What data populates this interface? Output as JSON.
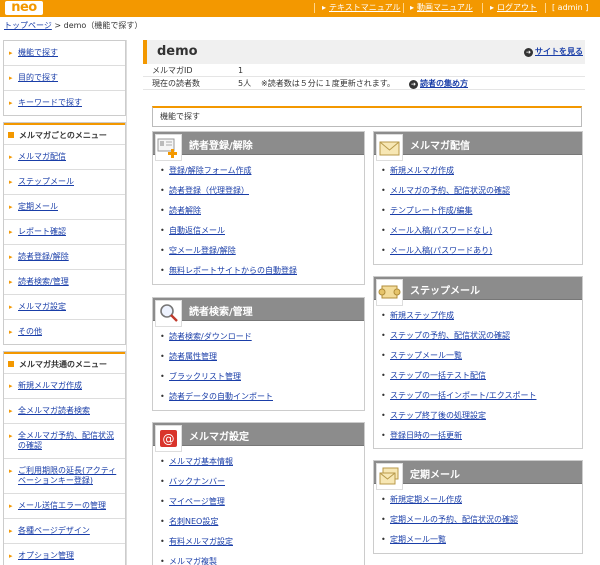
{
  "header": {
    "logo": "neo",
    "links": [
      {
        "label": "テキストマニュアル"
      },
      {
        "label": "動画マニュアル"
      },
      {
        "label": "ログアウト"
      }
    ],
    "user": "[ admin ]"
  },
  "breadcrumb": {
    "home": "トップページ",
    "sep": ">",
    "current": "demo（機能で探す）"
  },
  "sidebar": {
    "top_items": [
      "機能で探す",
      "目的で探す",
      "キーワードで探す"
    ],
    "magazine_menu": {
      "title": "メルマガごとのメニュー",
      "items": [
        "メルマガ配信",
        "ステップメール",
        "定期メール",
        "レポート確認",
        "読者登録/解除",
        "読者検索/管理",
        "メルマガ設定",
        "その他"
      ]
    },
    "common_menu": {
      "title": "メルマガ共通のメニュー",
      "items": [
        "新規メルマガ作成",
        "全メルマガ読者検索",
        "全メルマガ予約、配信状況の確認",
        "ご利用期限の延長(アクティベーションキー登録)",
        "メール送信エラーの管理",
        "各種ページデザイン",
        "オプション管理"
      ]
    }
  },
  "main": {
    "title": "demo",
    "site_link": "サイトを見る",
    "info": [
      {
        "key": "メルマガID",
        "value": "1"
      },
      {
        "key": "現在の読者数",
        "value": "5人",
        "note": "※読者数は５分に１度更新されます。",
        "link": "読者の集め方"
      }
    ],
    "func_label": "機能で探す",
    "panels": {
      "subscribe": {
        "title": "読者登録/解除",
        "items": [
          "登録/解除フォーム作成",
          "読者登録（代理登録）",
          "読者解除",
          "自動返信メール",
          "空メール登録/解除",
          "無料レポートサイトからの自動登録"
        ]
      },
      "search": {
        "title": "読者検索/管理",
        "items": [
          "読者検索/ダウンロード",
          "読者属性管理",
          "ブラックリスト管理",
          "読者データの自動インポート"
        ]
      },
      "settings": {
        "title": "メルマガ設定",
        "items": [
          "メルマガ基本情報",
          "バックナンバー",
          "マイページ管理",
          "名刺NEO設定",
          "有料メルマガ設定",
          "メルマガ複製"
        ]
      },
      "delivery": {
        "title": "メルマガ配信",
        "items": [
          "新規メルマガ作成",
          "メルマガの予約、配信状況の確認",
          "テンプレート作成/編集",
          "メール入稿(パスワードなし)",
          "メール入稿(パスワードあり)"
        ]
      },
      "step": {
        "title": "ステップメール",
        "items": [
          "新規ステップ作成",
          "ステップの予約、配信状況の確認",
          "ステップメール一覧",
          "ステップの一括テスト配信",
          "ステップの一括インポート/エクスポート",
          "ステップ終了後の処理設定",
          "登録日時の一括更新"
        ]
      },
      "periodic": {
        "title": "定期メール",
        "items": [
          "新規定期メール作成",
          "定期メールの予約、配信状況の確認",
          "定期メール一覧"
        ]
      }
    }
  },
  "colors": {
    "accent": "#f39800",
    "panel_header": "#8c8c8c",
    "link": "#1a3ea8"
  }
}
